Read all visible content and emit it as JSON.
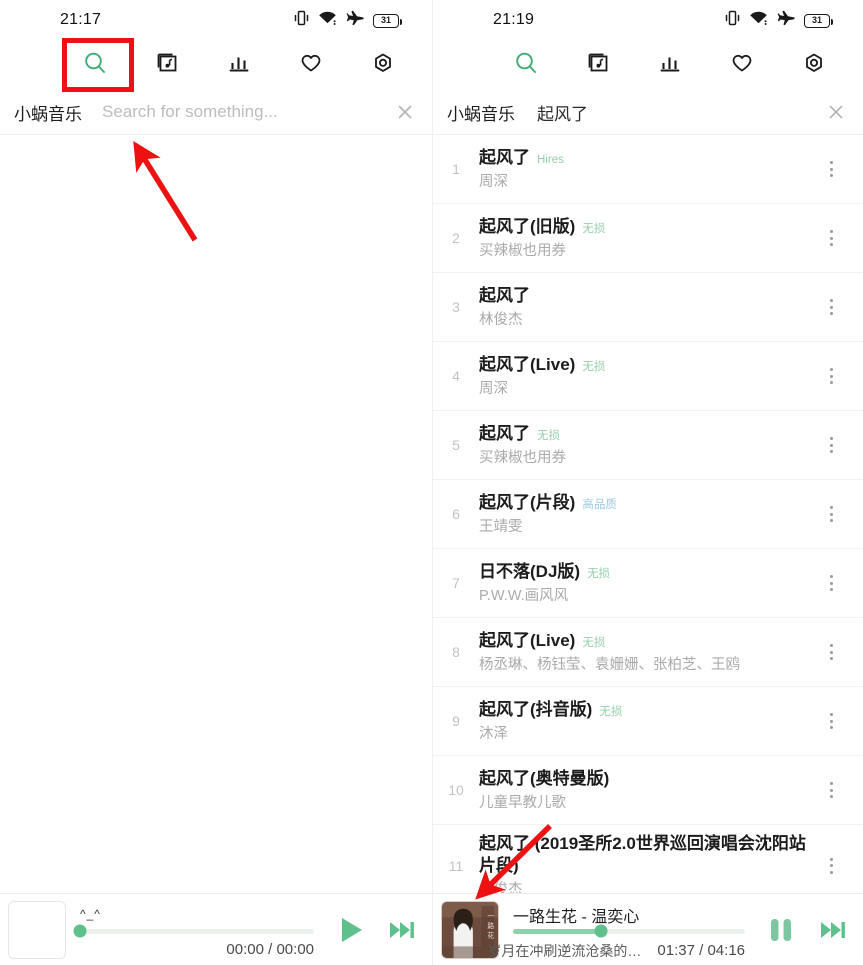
{
  "app": {
    "name": "小蜗音乐"
  },
  "colors": {
    "accent_green": "#4caf7d",
    "tag_green": "#96cfae",
    "tag_blue": "#9ec8de",
    "annotation_red": "#ee1111",
    "icon_dark": "#1a1a1a"
  },
  "left": {
    "status": {
      "time": "21:17",
      "battery": "31"
    },
    "toolbar": [
      {
        "name": "search-icon",
        "label": "Search",
        "active": true
      },
      {
        "name": "playlist-icon",
        "label": "Playlist",
        "active": false
      },
      {
        "name": "ranking-chart-icon",
        "label": "Ranking",
        "active": false
      },
      {
        "name": "heart-icon",
        "label": "Favorites",
        "active": false
      },
      {
        "name": "settings-hexagon-icon",
        "label": "Settings",
        "active": false
      }
    ],
    "search": {
      "value": "",
      "placeholder": "Search for something..."
    },
    "player": {
      "title": "^_^",
      "elapsed": "00:00",
      "duration": "00:00",
      "time_display": "00:00 / 00:00",
      "progress_percent": 0,
      "play_state": "paused",
      "play_button": "play-icon",
      "next_button": "next-track-icon"
    }
  },
  "right": {
    "status": {
      "time": "21:19",
      "battery": "31"
    },
    "toolbar": [
      {
        "name": "search-icon",
        "label": "Search",
        "active": true
      },
      {
        "name": "playlist-icon",
        "label": "Playlist",
        "active": false
      },
      {
        "name": "ranking-chart-icon",
        "label": "Ranking",
        "active": false
      },
      {
        "name": "heart-icon",
        "label": "Favorites",
        "active": false
      },
      {
        "name": "settings-hexagon-icon",
        "label": "Settings",
        "active": false
      }
    ],
    "search": {
      "value": "起风了",
      "placeholder": "Search for something..."
    },
    "songs": [
      {
        "index": "1",
        "title": "起风了",
        "tag": "Hires",
        "tag_color": "#96cfae",
        "artist": "周深"
      },
      {
        "index": "2",
        "title": "起风了(旧版)",
        "tag": "无损",
        "tag_color": "#96cfae",
        "artist": "买辣椒也用券"
      },
      {
        "index": "3",
        "title": "起风了",
        "tag": "",
        "tag_color": "#96cfae",
        "artist": "林俊杰"
      },
      {
        "index": "4",
        "title": "起风了(Live)",
        "tag": "无损",
        "tag_color": "#96cfae",
        "artist": "周深"
      },
      {
        "index": "5",
        "title": "起风了",
        "tag": "无损",
        "tag_color": "#96cfae",
        "artist": "买辣椒也用券"
      },
      {
        "index": "6",
        "title": "起风了(片段)",
        "tag": "高品质",
        "tag_color": "#9ec8de",
        "artist": "王靖雯"
      },
      {
        "index": "7",
        "title": "日不落(DJ版)",
        "tag": "无损",
        "tag_color": "#96cfae",
        "artist": "P.W.W.画风风"
      },
      {
        "index": "8",
        "title": "起风了(Live)",
        "tag": "无损",
        "tag_color": "#96cfae",
        "artist": "杨丞琳、杨钰莹、袁姗姗、张柏芝、王鸥"
      },
      {
        "index": "9",
        "title": "起风了(抖音版)",
        "tag": "无损",
        "tag_color": "#96cfae",
        "artist": "沐泽"
      },
      {
        "index": "10",
        "title": "起风了(奥特曼版)",
        "tag": "",
        "tag_color": "#96cfae",
        "artist": "儿童早教儿歌"
      },
      {
        "index": "11",
        "title": "起风了 (2019圣所2.0世界巡回演唱会沈阳站片段)",
        "tag": "",
        "tag_color": "#96cfae",
        "artist": "林俊杰"
      }
    ],
    "player": {
      "title": "一路生花 - 温奕心",
      "lyric": "岁月在冲刷逆流沧桑的…",
      "elapsed": "01:37",
      "duration": "04:16",
      "time_display": "01:37 / 04:16",
      "progress_percent": 38,
      "play_state": "playing",
      "play_button": "pause-icon",
      "next_button": "next-track-icon"
    }
  },
  "annotations": {
    "highlight_box": {
      "target": "search-icon",
      "color": "#ee1111"
    },
    "arrow_1": {
      "points_to": "search-input",
      "color": "#ee1111"
    },
    "arrow_2": {
      "points_to": "now-playing-album-art",
      "color": "#ee1111"
    }
  }
}
